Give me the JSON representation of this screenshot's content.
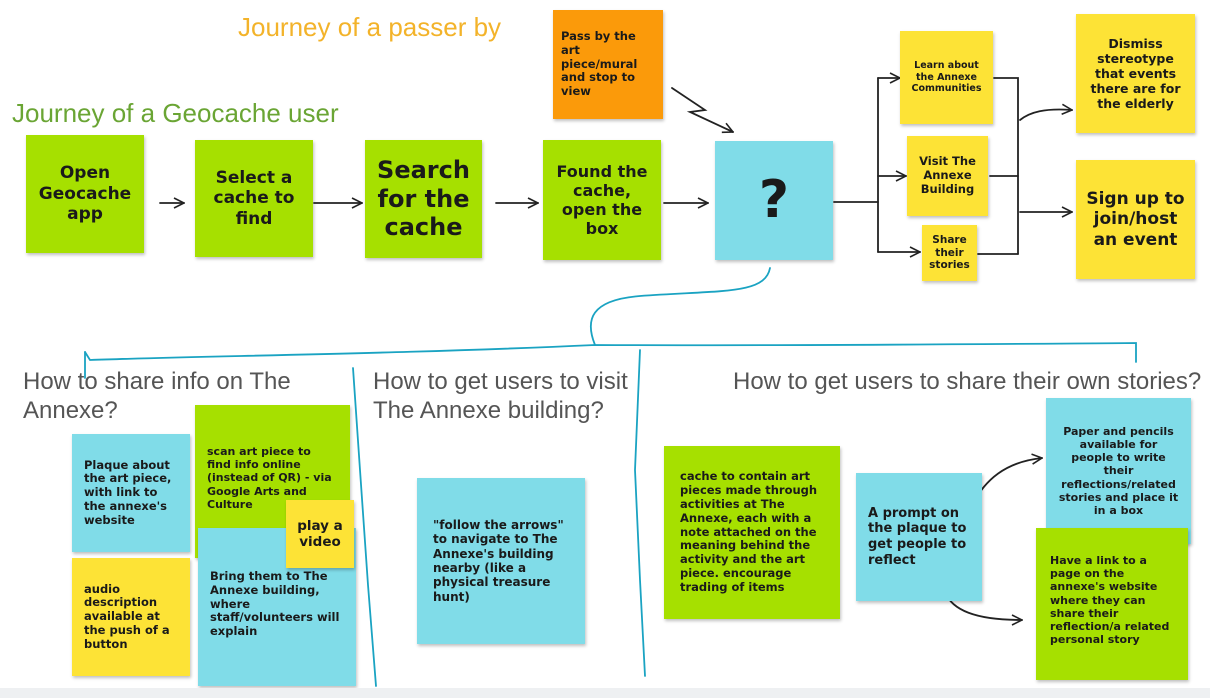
{
  "headings": {
    "passer_by": "Journey of a passer by",
    "geocache": "Journey of a Geocache user",
    "share_info": "How to share info on The Annexe?",
    "visit_building": "How to get users to visit The Annexe building?",
    "share_stories": "How to get users to share their own stories?"
  },
  "geocache_flow": {
    "open_app": "Open Geocache app",
    "select_cache": "Select a cache to find",
    "search_cache": "Search for the cache",
    "found_cache": "Found the cache, open the box",
    "question": "?"
  },
  "passer_by_flow": {
    "pass_by": "Pass by the art piece/mural and stop to view"
  },
  "outcomes": {
    "learn": "Learn about the Annexe Communities",
    "visit": "Visit The Annexe Building",
    "share": "Share their stories",
    "dismiss": "Dismiss stereotype that events there are for the elderly",
    "signup": "Sign up to join/host an event"
  },
  "share_info_notes": {
    "plaque": "Plaque about the art piece, with link to the annexe's website",
    "scan": "scan art piece to find info online (instead of QR) - via Google Arts and Culture",
    "video": "play a video",
    "audio": "audio description available at the push of a button",
    "bring": "Bring them to The Annexe building, where staff/volunteers will explain"
  },
  "visit_notes": {
    "arrows": "\"follow the arrows\" to navigate to The Annexe's building nearby (like a physical treasure hunt)"
  },
  "stories_notes": {
    "cache_art": "cache to contain art pieces made through activities at The Annexe, each with a note attached on the meaning behind the activity and the art piece. encourage trading of items",
    "prompt": "A prompt on the plaque to get people to reflect",
    "paper": "Paper and pencils available for people to write their reflections/related stories and place it in a box",
    "link": "Have a link to a page on the annexe's website where they can share their reflection/a related personal story"
  },
  "colors": {
    "green": "#a6e000",
    "blue": "#80dce8",
    "yellow": "#fde336",
    "orange": "#fb9a0a",
    "heading_orange": "#f3b32a",
    "heading_green": "#6aa534",
    "heading_gray": "#555555",
    "teal_line": "#1aa3c2"
  }
}
